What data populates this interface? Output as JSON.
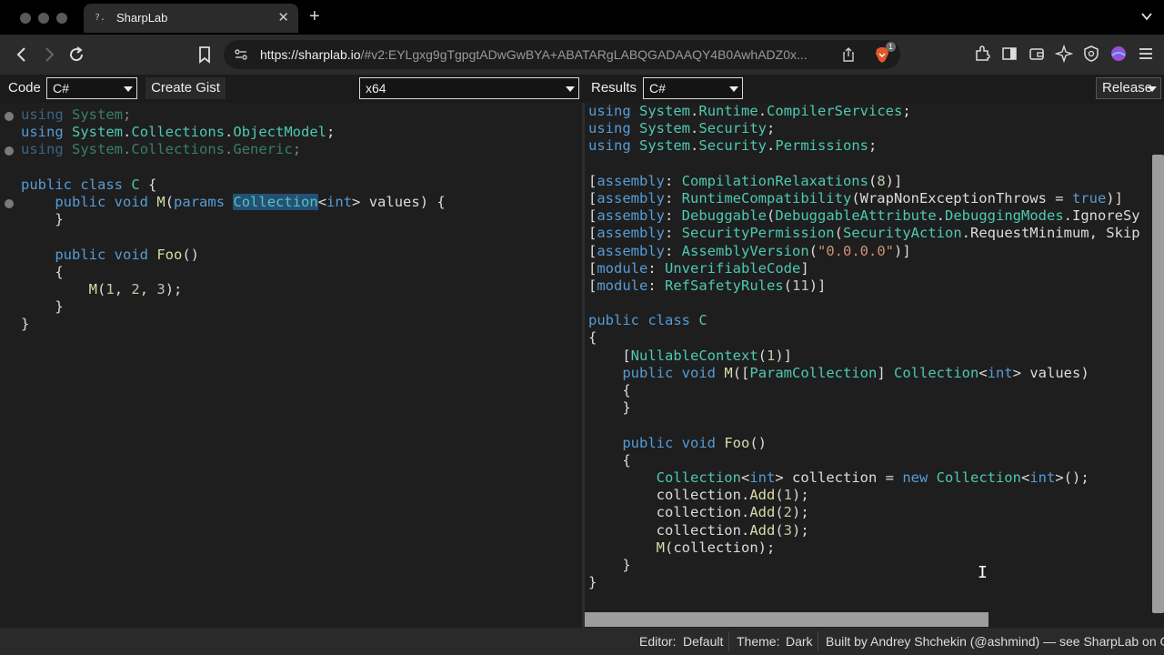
{
  "browser": {
    "tab_title": "SharpLab",
    "tab_favicon": "?.",
    "url_host": "https://sharplab.io",
    "url_path": "/#v2:EYLgxg9gTgpgtADwGwBYA+ABATARgLABQGADAAQY4B0AwhADZ0x...",
    "shields_count": "1",
    "icons": [
      "back-icon",
      "forward-icon",
      "reload-icon",
      "bookmark-icon",
      "site-settings-icon",
      "share-icon",
      "brave-shields-icon",
      "extensions-icon",
      "sidebar-icon",
      "wallet-icon",
      "leo-ai-icon",
      "vpn-icon",
      "profile-icon",
      "menu-icon"
    ]
  },
  "header": {
    "code_label": "Code",
    "language_select": "C#",
    "create_gist": "Create Gist",
    "platform_select": "x64",
    "results_label": "Results",
    "results_language_select": "C#",
    "build_mode_select": "Release"
  },
  "code_pane": {
    "lines": [
      "using System;",
      "using System.Collections.ObjectModel;",
      "using System.Collections.Generic;",
      "",
      "public class C {",
      "    public void M(params Collection<int> values) {",
      "    }",
      "",
      "    public void Foo()",
      "    {",
      "        M(1, 2, 3);",
      "    }",
      "}"
    ]
  },
  "results_pane": {
    "lines": [
      "using System.Runtime.CompilerServices;",
      "using System.Security;",
      "using System.Security.Permissions;",
      "",
      "[assembly: CompilationRelaxations(8)]",
      "[assembly: RuntimeCompatibility(WrapNonExceptionThrows = true)]",
      "[assembly: Debuggable(DebuggableAttribute.DebuggingModes.IgnoreSy",
      "[assembly: SecurityPermission(SecurityAction.RequestMinimum, Skip",
      "[assembly: AssemblyVersion(\"0.0.0.0\")]",
      "[module: UnverifiableCode]",
      "[module: RefSafetyRules(11)]",
      "",
      "public class C",
      "{",
      "    [NullableContext(1)]",
      "    public void M([ParamCollection] Collection<int> values)",
      "    {",
      "    }",
      "",
      "    public void Foo()",
      "    {",
      "        Collection<int> collection = new Collection<int>();",
      "        collection.Add(1);",
      "        collection.Add(2);",
      "        collection.Add(3);",
      "        M(collection);",
      "    }",
      "}"
    ]
  },
  "footer": {
    "editor_label": "Editor:",
    "editor_value": "Default",
    "theme_label": "Theme:",
    "theme_value": "Dark",
    "built_by": "Built by Andrey Shchekin (@ashmind) — see SharpLab on GitHub."
  },
  "colors": {
    "keyword": "#569cd6",
    "type": "#4ec9b0",
    "method": "#dcdcaa",
    "string": "#ce9178",
    "number": "#b5cea8",
    "editor_bg": "#1e1e1e",
    "selection": "#264f78"
  }
}
